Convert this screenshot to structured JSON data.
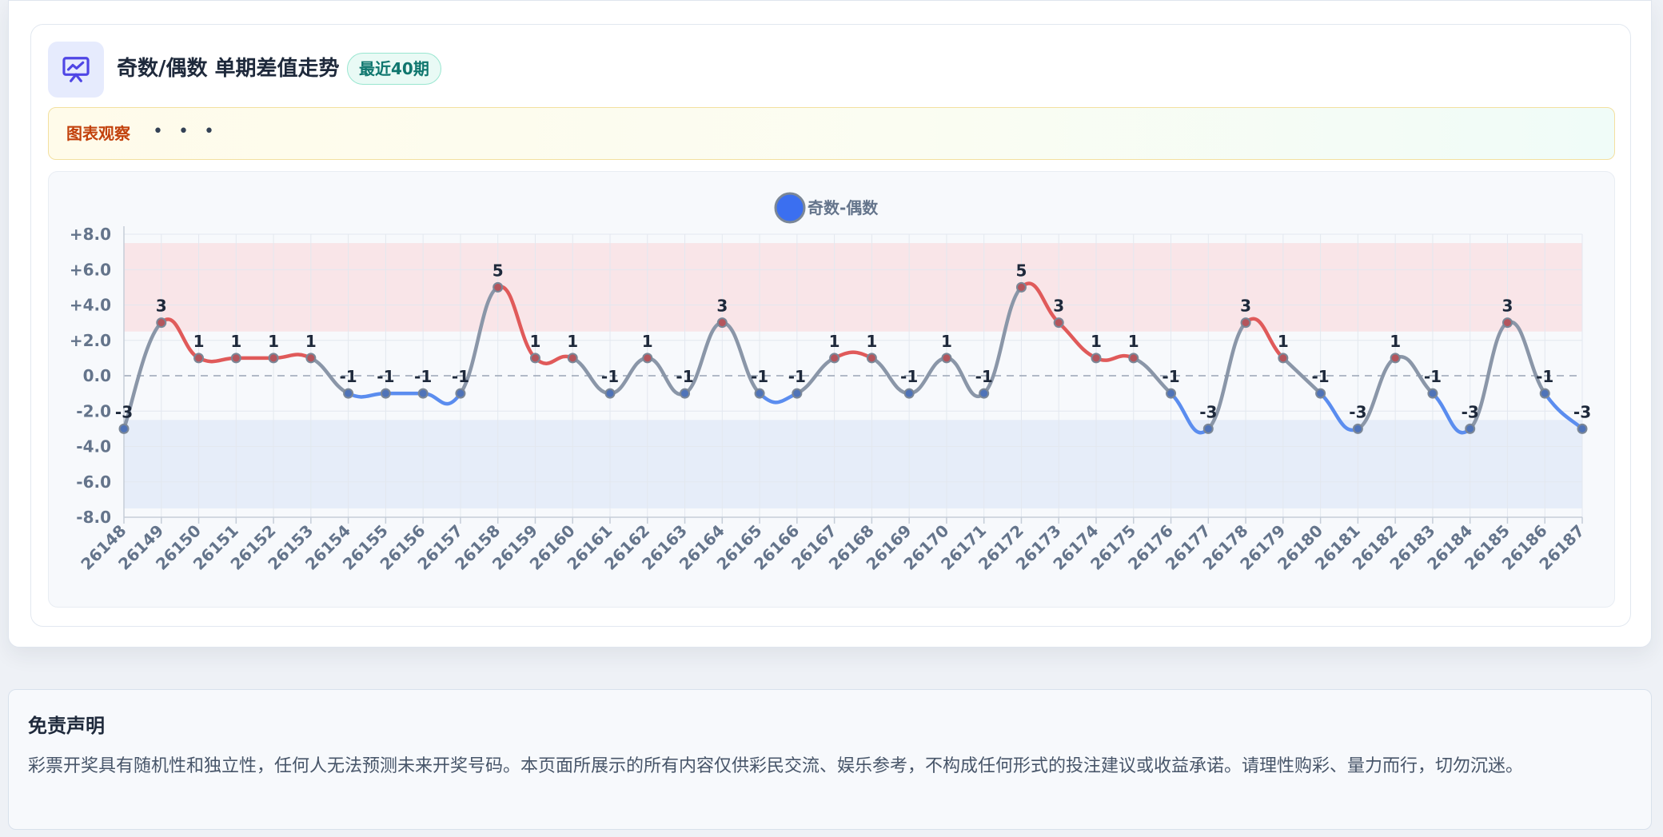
{
  "header": {
    "title": "奇数/偶数 单期差值走势",
    "badge": "最近40期"
  },
  "note": {
    "label": "图表观察",
    "dots": "• • •"
  },
  "colors": {
    "positive": "#e05a5a",
    "negative": "#5b8def",
    "neutral": "#8a96a8",
    "legend": "#3b6ff0"
  },
  "chart_data": {
    "type": "line",
    "legend_placement": "top-center",
    "grid": true,
    "ylim": [
      -8,
      8
    ],
    "yticks": [
      "+8.0",
      "+6.0",
      "+4.0",
      "+2.0",
      "0.0",
      "-2.0",
      "-4.0",
      "-6.0",
      "-8.0"
    ],
    "bands": [
      {
        "from": 2.5,
        "to": 7.5,
        "color": "#f9e5e8"
      },
      {
        "from": -7.5,
        "to": -2.5,
        "color": "#e6edf9"
      }
    ],
    "categories": [
      "26148",
      "26149",
      "26150",
      "26151",
      "26152",
      "26153",
      "26154",
      "26155",
      "26156",
      "26157",
      "26158",
      "26159",
      "26160",
      "26161",
      "26162",
      "26163",
      "26164",
      "26165",
      "26166",
      "26167",
      "26168",
      "26169",
      "26170",
      "26171",
      "26172",
      "26173",
      "26174",
      "26175",
      "26176",
      "26177",
      "26178",
      "26179",
      "26180",
      "26181",
      "26182",
      "26183",
      "26184",
      "26185",
      "26186",
      "26187"
    ],
    "series": [
      {
        "name": "奇数-偶数",
        "values": [
          -3,
          3,
          1,
          1,
          1,
          1,
          -1,
          -1,
          -1,
          -1,
          5,
          1,
          1,
          -1,
          1,
          -1,
          3,
          -1,
          -1,
          1,
          1,
          -1,
          1,
          -1,
          5,
          3,
          1,
          1,
          -1,
          -3,
          3,
          1,
          -1,
          -3,
          1,
          -1,
          -3,
          3,
          -1,
          -3
        ]
      }
    ]
  },
  "disclaimer": {
    "title": "免责声明",
    "text": "彩票开奖具有随机性和独立性，任何人无法预测未来开奖号码。本页面所展示的所有内容仅供彩民交流、娱乐参考，不构成任何形式的投注建议或收益承诺。请理性购彩、量力而行，切勿沉迷。"
  }
}
